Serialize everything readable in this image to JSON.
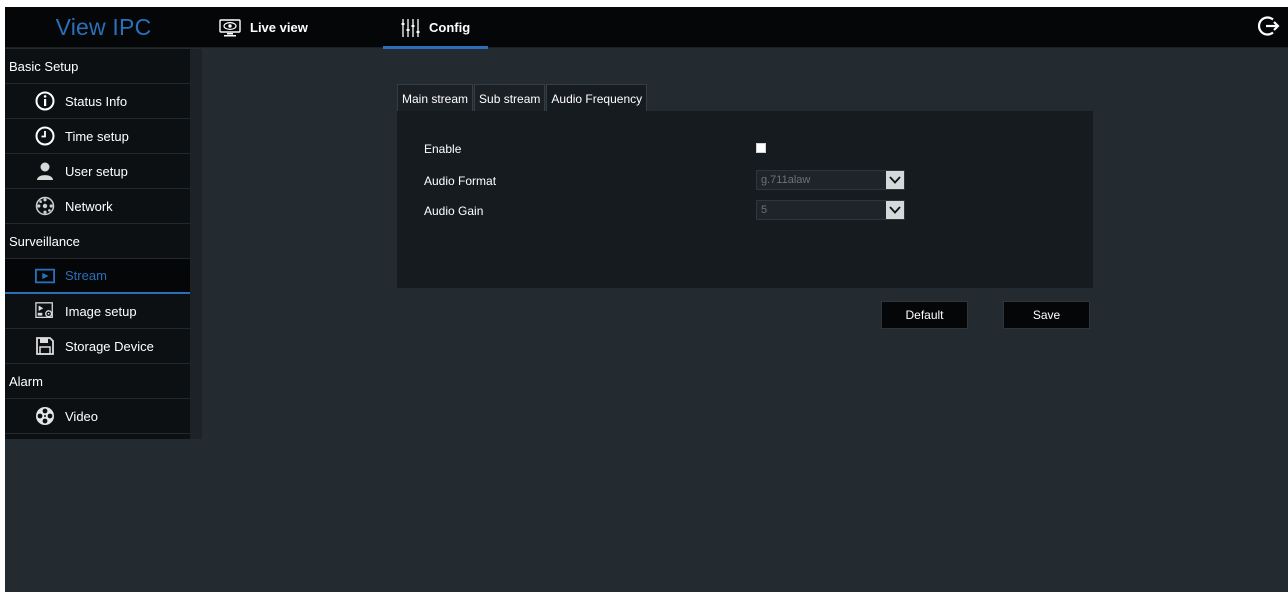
{
  "app": {
    "title": "View IPC"
  },
  "nav": {
    "live_view": "Live view",
    "config": "Config"
  },
  "sidebar": {
    "sections": [
      {
        "label": "Basic Setup"
      },
      {
        "label": "Surveillance"
      },
      {
        "label": "Alarm"
      }
    ],
    "items": [
      {
        "label": "Status Info",
        "icon": "info-icon"
      },
      {
        "label": "Time setup",
        "icon": "clock-icon"
      },
      {
        "label": "User setup",
        "icon": "user-icon"
      },
      {
        "label": "Network",
        "icon": "network-icon"
      },
      {
        "label": "Stream",
        "icon": "play-icon",
        "active": true
      },
      {
        "label": "Image setup",
        "icon": "image-settings-icon"
      },
      {
        "label": "Storage Device",
        "icon": "floppy-icon"
      },
      {
        "label": "Video",
        "icon": "film-reel-icon"
      }
    ]
  },
  "tabs": [
    {
      "label": "Main stream"
    },
    {
      "label": "Sub stream"
    },
    {
      "label": "Audio Frequency",
      "active": true
    }
  ],
  "form": {
    "enable_label": "Enable",
    "enable_checked": false,
    "audio_format_label": "Audio Format",
    "audio_format_value": "g.711alaw",
    "audio_gain_label": "Audio Gain",
    "audio_gain_value": "5"
  },
  "buttons": {
    "default": "Default",
    "save": "Save"
  },
  "colors": {
    "accent": "#2a6fb8",
    "background": "#232a30",
    "topbar": "#050607",
    "sidebar": "#0d1013",
    "panel": "#161b20"
  }
}
